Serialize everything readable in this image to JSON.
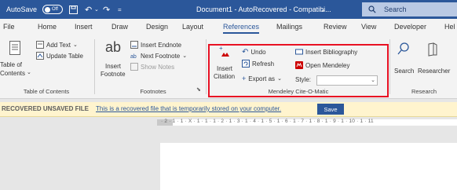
{
  "titlebar": {
    "autosave": "AutoSave",
    "toggle": "Off",
    "doc_title": "Document1 - AutoRecovered - Compatibi...",
    "chevron": "⌄",
    "search": "Search"
  },
  "tabs": [
    "File",
    "Home",
    "Insert",
    "Draw",
    "Design",
    "Layout",
    "References",
    "Mailings",
    "Review",
    "View",
    "Developer",
    "Hel"
  ],
  "ribbon": {
    "toc": {
      "table_of": "Table of",
      "contents": "Contents",
      "caret": "⌄",
      "add_text": "Add Text",
      "update_table": "Update Table",
      "group_label": "Table of Contents"
    },
    "footnotes": {
      "insert": "Insert",
      "footnote": "Footnote",
      "insert_endnote": "Insert Endnote",
      "next_footnote": "Next Footnote",
      "show_notes": "Show Notes",
      "group_label": "Footnotes",
      "ab": "ab"
    },
    "mendeley": {
      "insert": "Insert",
      "citation": "Citation",
      "undo": "Undo",
      "refresh": "Refresh",
      "export_as": "Export as",
      "insert_bibliography": "Insert Bibliography",
      "open_mendeley": "Open Mendeley",
      "style": "Style:",
      "group_label": "Mendeley Cite-O-Matic"
    },
    "research": {
      "search": "Search",
      "researcher": "Researcher",
      "group_label": "Research"
    }
  },
  "infobar": {
    "label": "RECOVERED UNSAVED FILE",
    "message": "This is a recovered file that is temporarily stored on your computer.",
    "save": "Save"
  },
  "ruler": {
    "text": "· 2 · 1 · 1 · X · 1 · 1 · 1 · 2 · 1 · 3 · 1 · 4 · 1 · 5 · 1 · 6 · 1 · 7 · 1 · 8 · 1 · 9 · 1 · 10 · 1 · 11"
  },
  "colors": {
    "word_blue": "#2b579a",
    "highlight_red": "#e81123",
    "infobar_bg": "#fff4ce"
  }
}
